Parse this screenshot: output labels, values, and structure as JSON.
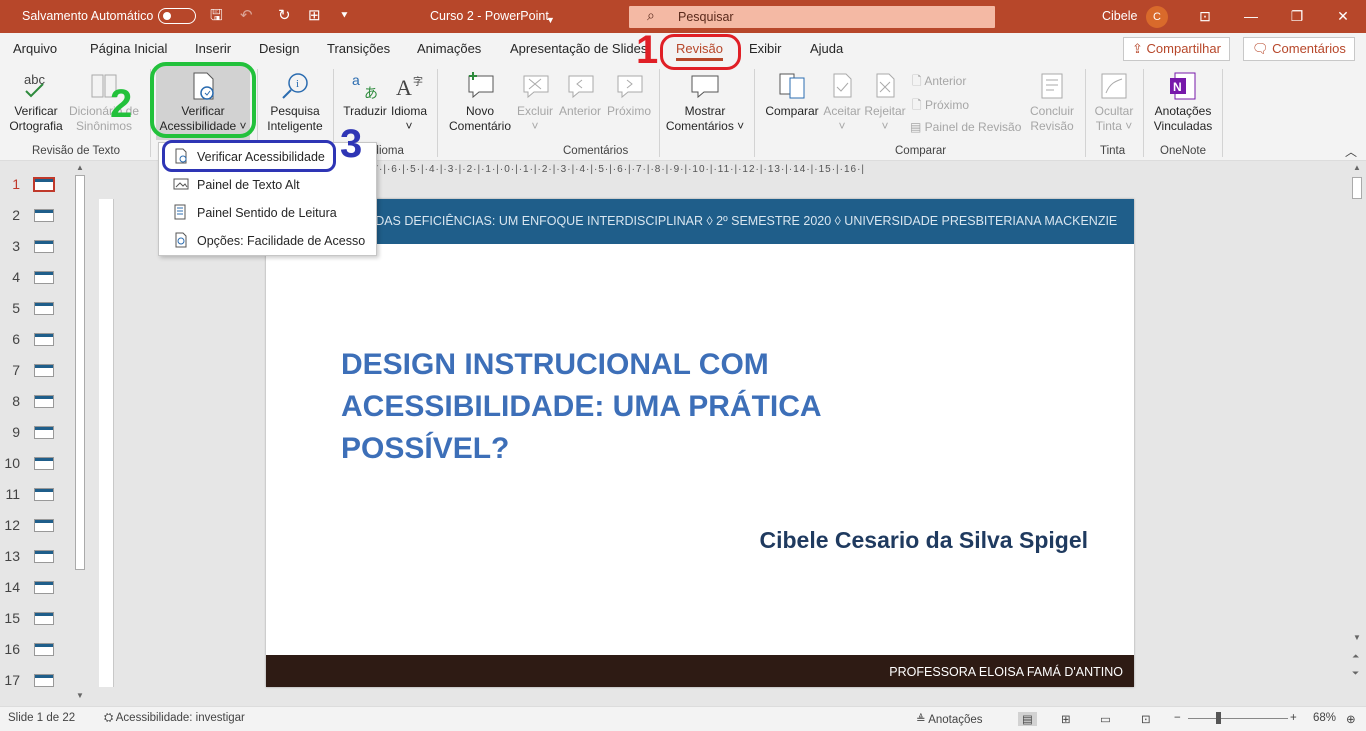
{
  "titlebar": {
    "autosave": "Salvamento Automático",
    "doc_title": "Curso 2 - PowerPoint",
    "search_placeholder": "Pesquisar",
    "user_name": "Cibele",
    "user_initial": "C"
  },
  "menu_tabs": [
    "Arquivo",
    "Página Inicial",
    "Inserir",
    "Design",
    "Transições",
    "Animações",
    "Apresentação de Slides",
    "Revisão",
    "Exibir",
    "Ajuda"
  ],
  "active_tab": "Revisão",
  "share_label": "Compartilhar",
  "comments_label": "Comentários",
  "ribbon": {
    "verificar_ortografia": [
      "Verificar",
      "Ortografia"
    ],
    "dicionario": [
      "Dicionário de",
      "Sinônimos"
    ],
    "verificar_acess": [
      "Verificar",
      "Acessibilidade ˅"
    ],
    "pesquisa": [
      "Pesquisa",
      "Inteligente"
    ],
    "traduzir": "Traduzir",
    "idioma": "Idioma",
    "novo_comentario": [
      "Novo",
      "Comentário"
    ],
    "excluir": "Excluir",
    "anterior": "Anterior",
    "proximo": "Próximo",
    "mostrar_comentarios": [
      "Mostrar",
      "Comentários ˅"
    ],
    "comparar": "Comparar",
    "aceitar": "Aceitar",
    "rejeitar": "Rejeitar",
    "anterior_small": "Anterior",
    "proximo_small": "Próximo",
    "painel_revisao": "Painel de Revisão",
    "concluir_revisao": [
      "Concluir",
      "Revisão"
    ],
    "ocultar_tinta": [
      "Ocultar",
      "Tinta ˅"
    ],
    "anotacoes_vinculadas": [
      "Anotações",
      "Vinculadas"
    ],
    "group_labels": [
      "Revisão de Texto",
      "idioma",
      "Comentários",
      "Comparar",
      "Tinta",
      "OneNote"
    ]
  },
  "dropdown_items": [
    {
      "label": "Verificar Acessibilidade",
      "icon": "accessibility-check-icon"
    },
    {
      "label": "Painel de Texto Alt",
      "icon": "alt-text-icon"
    },
    {
      "label": "Painel Sentido de Leitura",
      "icon": "reading-order-icon"
    },
    {
      "label": "Opções: Facilidade de Acesso",
      "icon": "ease-of-access-icon"
    }
  ],
  "annotations": {
    "n1": "1",
    "n2": "2",
    "n3": "3"
  },
  "slide_numbers": [
    "1",
    "2",
    "3",
    "4",
    "5",
    "6",
    "7",
    "8",
    "9",
    "10",
    "11",
    "12",
    "13",
    "14",
    "15",
    "16",
    "17"
  ],
  "selected_slide": 1,
  "ruler_text": "|12|·1·|·10·|·9·|·8·|·7·|·6·|·5·|·4·|·3·|·2·|·1·|·0·|·1·|·2·|·3·|·4·|·5·|·6·|·7·|·8·|·9·|·10·|·11·|·12·|·13·|·14·|·15·|·16·|",
  "slide": {
    "header_text": "O DAS DEFICIÊNCIAS: UM ENFOQUE INTERDISCIPLINAR ◊ 2º SEMESTRE 2020 ◊ UNIVERSIDADE PRESBITERIANA MACKENZIE",
    "title": "DESIGN INSTRUCIONAL COM ACESSIBILIDADE: UMA PRÁTICA POSSÍVEL?",
    "author": "Cibele Cesario da Silva Spigel",
    "footer": "PROFESSORA ELOISA FAMÁ D'ANTINO"
  },
  "status": {
    "slide_count": "Slide 1 de 22",
    "accessibility": "Acessibilidade: investigar",
    "notes": "Anotações",
    "zoom": "68%"
  },
  "colors": {
    "accent": "#b7472a",
    "slide_header": "#1f5e8a",
    "title_blue": "#3d6fb8"
  }
}
